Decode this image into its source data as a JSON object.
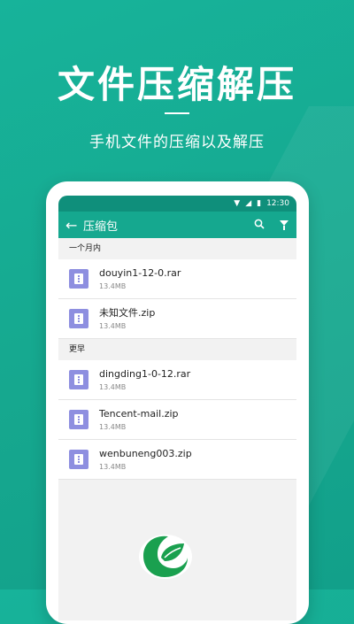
{
  "headline": "文件压缩解压",
  "subtitle": "手机文件的压缩以及解压",
  "phone": {
    "status": {
      "time": "12:30"
    },
    "toolbar": {
      "title": "压缩包"
    },
    "sections": [
      {
        "header": "一个月内",
        "files": [
          {
            "name": "douyin1-12-0.rar",
            "size": "13.4MB"
          },
          {
            "name": "未知文件.zip",
            "size": "13.4MB"
          }
        ]
      },
      {
        "header": "更早",
        "files": [
          {
            "name": "dingding1-0-12.rar",
            "size": "13.4MB"
          },
          {
            "name": "Tencent-mail.zip",
            "size": "13.4MB"
          },
          {
            "name": "wenbuneng003.zip",
            "size": "13.4MB"
          }
        ]
      }
    ]
  },
  "colors": {
    "background": "#16a88f",
    "accent": "#15a88f",
    "statusbar": "#0f8f7b",
    "file_icon": "#8e8fe0",
    "logo_green": "#1aa04f"
  },
  "icons": [
    "back-arrow-icon",
    "search-icon",
    "filter-icon",
    "wifi-icon",
    "signal-icon",
    "battery-icon",
    "archive-file-icon",
    "leaf-logo-icon"
  ]
}
